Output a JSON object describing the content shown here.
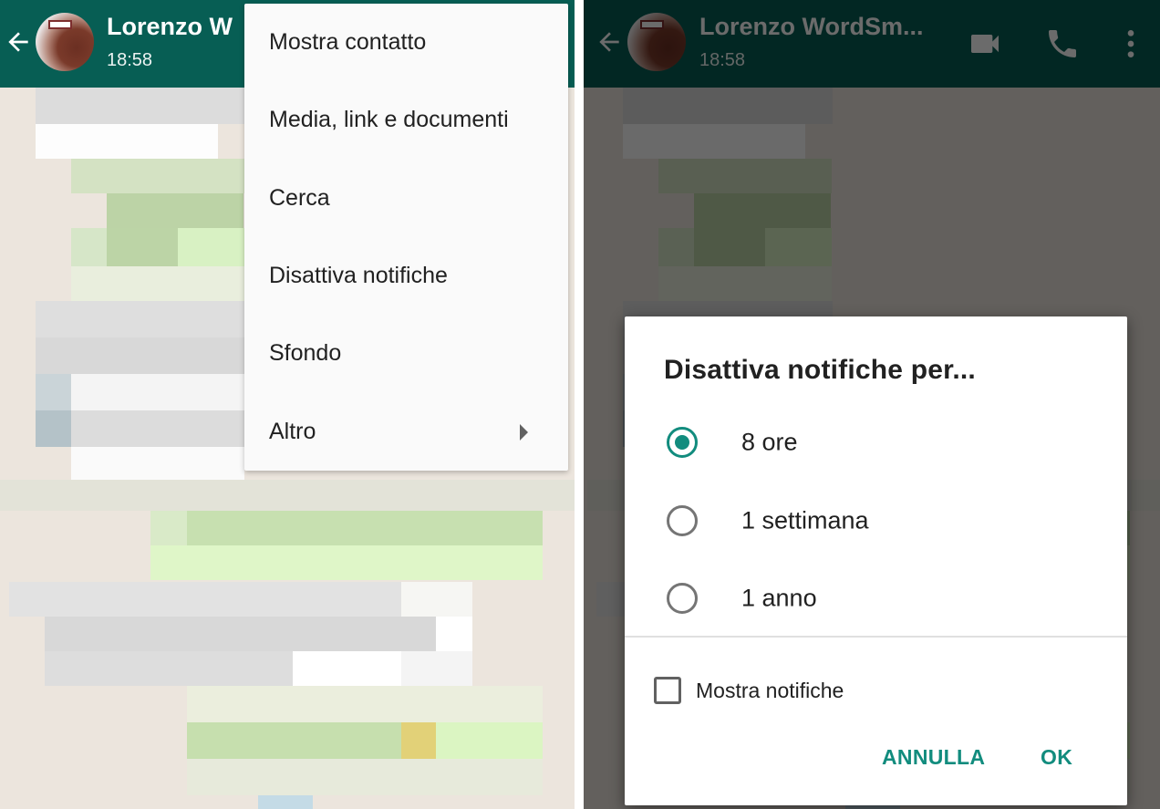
{
  "left_screen": {
    "header": {
      "contact_name": "Lorenzo W",
      "last_seen": "18:58",
      "back_icon": "arrow-left-icon"
    },
    "overflow_menu": {
      "items": [
        {
          "label": "Mostra contatto"
        },
        {
          "label": "Media, link e documenti"
        },
        {
          "label": "Cerca"
        },
        {
          "label": "Disattiva notifiche"
        },
        {
          "label": "Sfondo"
        },
        {
          "label": "Altro",
          "has_submenu": true,
          "submenu_icon": "triangle-right-icon"
        }
      ]
    }
  },
  "right_screen": {
    "header": {
      "contact_name": "Lorenzo WordSm...",
      "last_seen": "18:58",
      "back_icon": "arrow-left-icon",
      "actions": [
        {
          "icon": "video-call-icon"
        },
        {
          "icon": "phone-icon"
        },
        {
          "icon": "more-vert-icon"
        }
      ]
    },
    "mute_dialog": {
      "title": "Disattiva notifiche per...",
      "options": [
        {
          "label": "8 ore",
          "selected": true
        },
        {
          "label": "1 settimana",
          "selected": false
        },
        {
          "label": "1 anno",
          "selected": false
        }
      ],
      "show_notifications": {
        "label": "Mostra notifiche",
        "checked": false
      },
      "cancel_label": "ANNULLA",
      "ok_label": "OK"
    }
  },
  "colors": {
    "header": "#075e54",
    "accent": "#128c7e",
    "chat_background": "#ece5dd",
    "outgoing_bubble": "#dcf8c6",
    "incoming_bubble": "#ffffff"
  }
}
